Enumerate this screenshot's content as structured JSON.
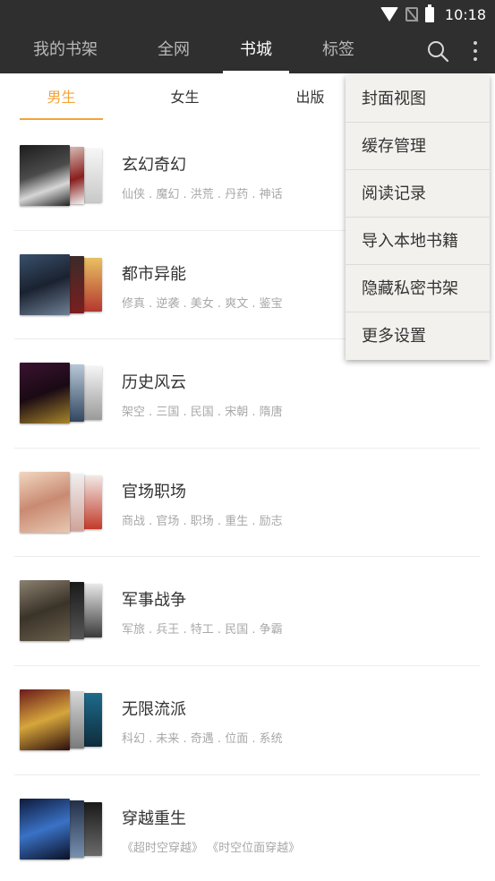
{
  "status_bar": {
    "time": "10:18"
  },
  "toolbar": {
    "tabs": [
      "我的书架",
      "全网",
      "书城",
      "标签"
    ],
    "active_tab": "书城"
  },
  "sub_tabs": {
    "tabs": [
      "男生",
      "女生",
      "出版"
    ],
    "active": "男生",
    "accent_color": "#f5a338"
  },
  "categories": [
    {
      "title": "玄幻奇幻",
      "tags": "仙侠 . 魔幻 . 洪荒 . 丹药 . 神话"
    },
    {
      "title": "都市异能",
      "tags": "修真 . 逆袭 . 美女 . 爽文 . 鉴宝"
    },
    {
      "title": "历史风云",
      "tags": "架空 . 三国 . 民国 . 宋朝 . 隋唐"
    },
    {
      "title": "官场职场",
      "tags": "商战 . 官场 . 职场 . 重生 . 励志"
    },
    {
      "title": "军事战争",
      "tags": "军旅 . 兵王 . 特工 . 民国 . 争霸"
    },
    {
      "title": "无限流派",
      "tags": "科幻 . 未来 . 奇遇 . 位面 . 系统"
    },
    {
      "title": "穿越重生",
      "tags": "《超时空穿越》 《时空位面穿越》"
    }
  ],
  "menu": {
    "items": [
      "封面视图",
      "缓存管理",
      "阅读记录",
      "导入本地书籍",
      "隐藏私密书架",
      "更多设置"
    ]
  },
  "colors": {
    "toolbar_bg": "#2f2f2f",
    "menu_bg": "#f3f1ee"
  }
}
